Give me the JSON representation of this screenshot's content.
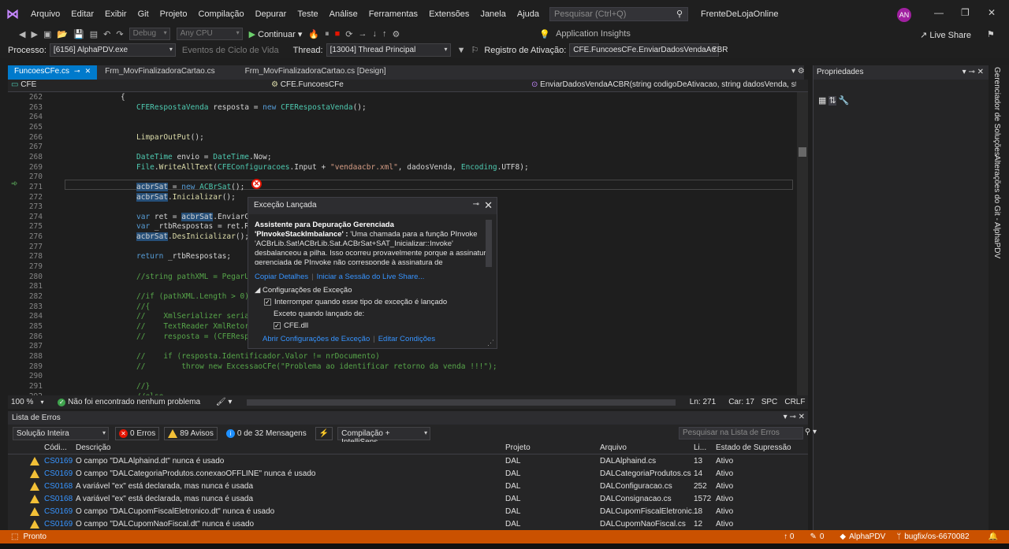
{
  "menu": {
    "items": [
      "Arquivo",
      "Editar",
      "Exibir",
      "Git",
      "Projeto",
      "Compilação",
      "Depurar",
      "Teste",
      "Análise",
      "Ferramentas",
      "Extensões",
      "Janela",
      "Ajuda"
    ],
    "search_placeholder": "Pesquisar (Ctrl+Q)",
    "solution_name": "FrenteDeLojaOnline",
    "avatar": "AN"
  },
  "toolbar": {
    "config": "Debug",
    "platform": "Any CPU",
    "continue_label": "Continuar",
    "app_insights": "Application Insights",
    "live_share": "Live Share"
  },
  "debug_bar": {
    "process_label": "Processo:",
    "process_value": "[6156] AlphaPDV.exe",
    "lifecycle": "Eventos de Ciclo de Vida",
    "thread_label": "Thread:",
    "thread_value": "[13004] Thread Principal",
    "activation_label": "Registro de Ativação:",
    "activation_value": "CFE.FuncoesCFe.EnviarDadosVendaACBR"
  },
  "tabs": [
    {
      "label": "FuncoesCFe.cs"
    },
    {
      "label": "Frm_MovFinalizadoraCartao.cs"
    },
    {
      "label": "Frm_MovFinalizadoraCartao.cs [Design]"
    }
  ],
  "nav": {
    "project": "CFE",
    "class": "CFE.FuncoesCFe",
    "method": "EnviarDadosVendaACBR(string codigoDeAtivacao, string dadosVenda, st"
  },
  "code_lines": [
    {
      "n": "262",
      "t": "{"
    },
    {
      "n": "263",
      "t": "CFERespostaVenda resposta = new CFERespostaVenda();"
    },
    {
      "n": "264",
      "t": ""
    },
    {
      "n": "265",
      "t": ""
    },
    {
      "n": "266",
      "t": "LimparOutPut();"
    },
    {
      "n": "267",
      "t": ""
    },
    {
      "n": "268",
      "t": "DateTime envio = DateTime.Now;"
    },
    {
      "n": "269",
      "t": "File.WriteAllText(CFEConfiguracoes.Input + \"vendaacbr.xml\", dadosVenda, Encoding.UTF8);"
    },
    {
      "n": "270",
      "t": ""
    },
    {
      "n": "271",
      "t": "acbrSat = new ACBrSat();"
    },
    {
      "n": "272",
      "t": "acbrSat.Inicializar();"
    },
    {
      "n": "273",
      "t": ""
    },
    {
      "n": "274",
      "t": "var ret = acbrSat.EnviarC"
    },
    {
      "n": "275",
      "t": "var _rtbRespostas = ret.R"
    },
    {
      "n": "276",
      "t": "acbrSat.DesInicializar();"
    },
    {
      "n": "277",
      "t": ""
    },
    {
      "n": "278",
      "t": "return _rtbRespostas;"
    },
    {
      "n": "279",
      "t": ""
    },
    {
      "n": "280",
      "t": "//string pathXML = PegarU"
    },
    {
      "n": "281",
      "t": ""
    },
    {
      "n": "282",
      "t": "//if (pathXML.Length > 0)"
    },
    {
      "n": "283",
      "t": "//{"
    },
    {
      "n": "284",
      "t": "//    XmlSerializer seria"
    },
    {
      "n": "285",
      "t": "//    TextReader XmlRetor"
    },
    {
      "n": "286",
      "t": "//    resposta = (CFEResp"
    },
    {
      "n": "287",
      "t": ""
    },
    {
      "n": "288",
      "t": "//    if (resposta.Identificador.Valor != nrDocumento)"
    },
    {
      "n": "289",
      "t": "//        throw new ExcessaoCFe(\"Problema ao identificar retorno da venda !!!\");"
    },
    {
      "n": "290",
      "t": ""
    },
    {
      "n": "291",
      "t": "//}"
    },
    {
      "n": "292",
      "t": "//else"
    }
  ],
  "popup": {
    "title": "Exceção Lançada",
    "assistant": "Assistente para Depuração Gerenciada",
    "mda_name": "'PInvokeStackImbalance' :",
    "message": "'Uma chamada para a função PInvoke 'ACBrLib.Sat!ACBrLib.Sat.ACBrSat+SAT_Inicializar::Invoke' desbalanceou a pilha. Isso ocorreu provavelmente porque a assinatura gerenciada de PInvoke não corresponde à assinatura de",
    "copy_details": "Copiar Detalhes",
    "live_share_session": "Iniciar a Sessão do Live Share...",
    "settings_header": "Configurações de Exceção",
    "break_label": "Interromper quando esse tipo de exceção é lançado",
    "except_label": "Exceto quando lançado de:",
    "module": "CFE.dll",
    "open_settings": "Abrir Configurações de Exceção",
    "edit_conditions": "Editar Condições"
  },
  "editor_status": {
    "zoom": "100 %",
    "issues": "Não foi encontrado nenhum problema",
    "line": "Ln: 271",
    "col": "Car: 17",
    "spc": "SPC",
    "crlf": "CRLF"
  },
  "properties": {
    "title": "Propriedades"
  },
  "side_tabs": [
    "Gerenciador de Soluções",
    "Alterações do Git - AlphaPDV"
  ],
  "error_list": {
    "title": "Lista de Erros",
    "scope": "Solução Inteira",
    "errors": "0 Erros",
    "warnings": "89 Avisos",
    "messages": "0 de 32 Mensagens",
    "build": "Compilação + IntelliSens",
    "search_placeholder": "Pesquisar na Lista de Erros",
    "columns": [
      "Códi...",
      "Descrição",
      "Projeto",
      "Arquivo",
      "Li...",
      "Estado de Supressão"
    ],
    "rows": [
      {
        "code": "CS0169",
        "desc": "O campo \"DALAlphaind.dt\" nunca é usado",
        "project": "DAL",
        "file": "DALAlphaind.cs",
        "line": "13",
        "state": "Ativo"
      },
      {
        "code": "CS0169",
        "desc": "O campo \"DALCategoriaProdutos.conexaoOFFLINE\" nunca é usado",
        "project": "DAL",
        "file": "DALCategoriaProdutos.cs",
        "line": "14",
        "state": "Ativo"
      },
      {
        "code": "CS0168",
        "desc": "A variável \"ex\" está declarada, mas nunca é usada",
        "project": "DAL",
        "file": "DALConfiguracao.cs",
        "line": "252",
        "state": "Ativo"
      },
      {
        "code": "CS0168",
        "desc": "A variável \"ex\" está declarada, mas nunca é usada",
        "project": "DAL",
        "file": "DALConsignacao.cs",
        "line": "1572",
        "state": "Ativo"
      },
      {
        "code": "CS0169",
        "desc": "O campo \"DALCupomFiscalEletronico.dt\" nunca é usado",
        "project": "DAL",
        "file": "DALCupomFiscalEletronic...",
        "line": "18",
        "state": "Ativo"
      },
      {
        "code": "CS0169",
        "desc": "O campo \"DALCupomNaoFiscal.dt\" nunca é usado",
        "project": "DAL",
        "file": "DALCupomNaoFiscal.cs",
        "line": "12",
        "state": "Ativo"
      }
    ]
  },
  "status": {
    "ready": "Pronto",
    "up": "↑ 0",
    "pencil": "0",
    "repo": "AlphaPDV",
    "branch": "bugfix/os-6670082"
  },
  "colors": {
    "accent": "#007acc",
    "status_bar": "#ca5100",
    "error": "#e51400",
    "warning": "#f2c037"
  }
}
